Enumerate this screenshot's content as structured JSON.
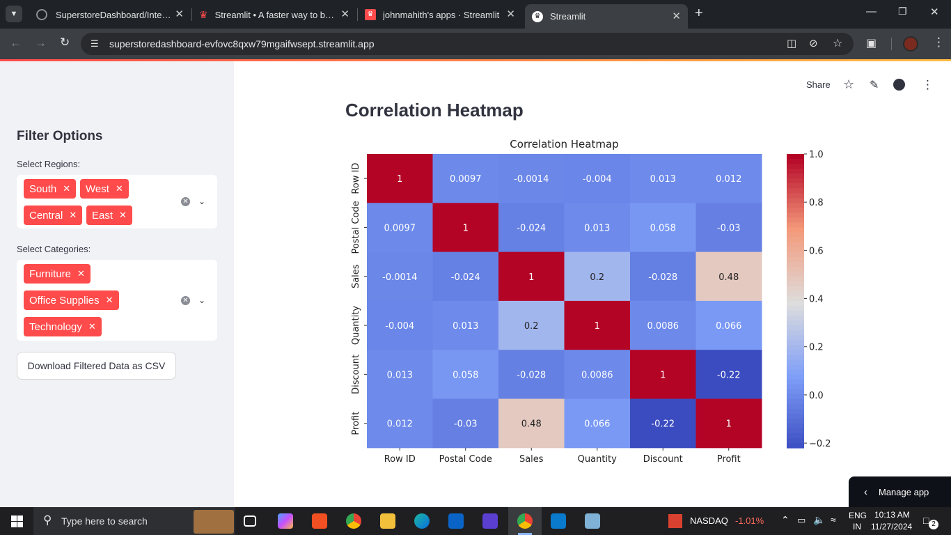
{
  "browser": {
    "tabs": [
      {
        "title": "SuperstoreDashboard/Interactiv",
        "active": false
      },
      {
        "title": "Streamlit • A faster way to build",
        "active": false
      },
      {
        "title": "johnmahith's apps · Streamlit",
        "active": false
      },
      {
        "title": "Streamlit",
        "active": true
      }
    ],
    "url": "superstoredashboard-evfovc8qxw79mgaifwsept.streamlit.app"
  },
  "sidebar": {
    "title": "Filter Options",
    "regions_label": "Select Regions:",
    "regions": [
      "South",
      "West",
      "Central",
      "East"
    ],
    "categories_label": "Select Categories:",
    "categories": [
      "Furniture",
      "Office Supplies",
      "Technology"
    ],
    "download_label": "Download Filtered Data as CSV"
  },
  "header": {
    "share_label": "Share"
  },
  "main": {
    "title": "Correlation Heatmap"
  },
  "manage_app_label": "Manage app",
  "taskbar": {
    "search_placeholder": "Type here to search",
    "ticker_name": "NASDAQ",
    "ticker_change": "-1.01%",
    "lang_top": "ENG",
    "lang_bottom": "IN",
    "time": "10:13 AM",
    "date": "11/27/2024",
    "notifications": "2"
  },
  "chart_data": {
    "type": "heatmap",
    "title": "Correlation Heatmap",
    "labels": [
      "Row ID",
      "Postal Code",
      "Sales",
      "Quantity",
      "Discount",
      "Profit"
    ],
    "matrix": [
      [
        1,
        0.0097,
        -0.0014,
        -0.004,
        0.013,
        0.012
      ],
      [
        0.0097,
        1,
        -0.024,
        0.013,
        0.058,
        -0.03
      ],
      [
        -0.0014,
        -0.024,
        1,
        0.2,
        -0.028,
        0.48
      ],
      [
        -0.004,
        0.013,
        0.2,
        1,
        0.0086,
        0.066
      ],
      [
        0.013,
        0.058,
        -0.028,
        0.0086,
        1,
        -0.22
      ],
      [
        0.012,
        -0.03,
        0.48,
        0.066,
        -0.22,
        1
      ]
    ],
    "annotations": [
      [
        "1",
        "0.0097",
        "-0.0014",
        "-0.004",
        "0.013",
        "0.012"
      ],
      [
        "0.0097",
        "1",
        "-0.024",
        "0.013",
        "0.058",
        "-0.03"
      ],
      [
        "-0.0014",
        "-0.024",
        "1",
        "0.2",
        "-0.028",
        "0.48"
      ],
      [
        "-0.004",
        "0.013",
        "0.2",
        "1",
        "0.0086",
        "0.066"
      ],
      [
        "0.013",
        "0.058",
        "-0.028",
        "0.0086",
        "1",
        "-0.22"
      ],
      [
        "0.012",
        "-0.03",
        "0.48",
        "0.066",
        "-0.22",
        "1"
      ]
    ],
    "colormap": "coolwarm",
    "vmin": -0.22,
    "vmax": 1.0,
    "colorbar_ticks": [
      {
        "value": 1.0,
        "label": "1.0"
      },
      {
        "value": 0.8,
        "label": "0.8"
      },
      {
        "value": 0.6,
        "label": "0.6"
      },
      {
        "value": 0.4,
        "label": "0.4"
      },
      {
        "value": 0.2,
        "label": "0.2"
      },
      {
        "value": 0.0,
        "label": "0.0"
      },
      {
        "value": -0.2,
        "label": "−0.2"
      }
    ]
  }
}
